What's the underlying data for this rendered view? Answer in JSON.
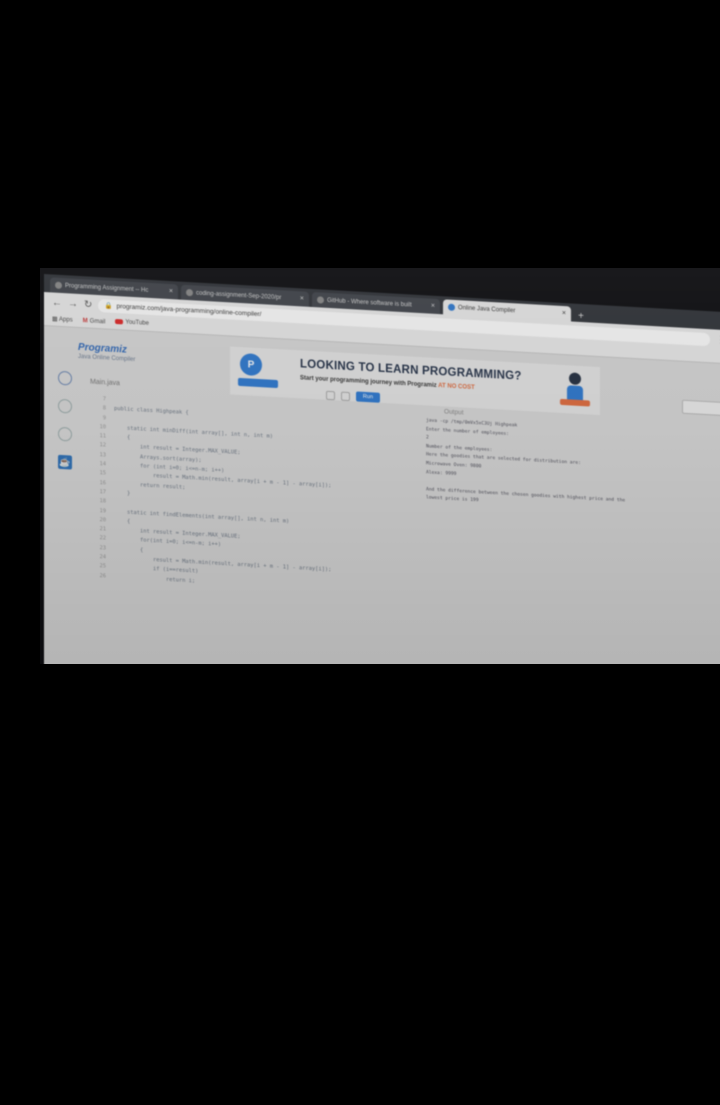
{
  "browser": {
    "tabs": [
      {
        "label": "Programming Assignment -- Hc",
        "active": false
      },
      {
        "label": "coding-assignment-Sep-2020/pr",
        "active": false
      },
      {
        "label": "GitHub - Where software is built",
        "active": false
      },
      {
        "label": "Online Java Compiler",
        "active": true
      }
    ],
    "url": "programiz.com/java-programming/online-compiler/",
    "bookmarks": [
      "Apps",
      "Gmail",
      "YouTube"
    ]
  },
  "brand": {
    "logo": "Programiz",
    "subtitle": "Java Online Compiler"
  },
  "banner": {
    "title": "LOOKING TO LEARN PROGRAMMING?",
    "subtitle": "Start your programming journey with Programiz",
    "accent": "AT NO COST"
  },
  "editor": {
    "file_name": "Main.java",
    "run_label": "Run",
    "lines": [
      {
        "n": "7",
        "text": ""
      },
      {
        "n": "8",
        "text": "public class Highpeak {"
      },
      {
        "n": "9",
        "text": ""
      },
      {
        "n": "10",
        "text": "    static int minDiff(int array[], int n, int m)"
      },
      {
        "n": "11",
        "text": "    {"
      },
      {
        "n": "12",
        "text": "        int result = Integer.MAX_VALUE;"
      },
      {
        "n": "13",
        "text": "        Arrays.sort(array);"
      },
      {
        "n": "14",
        "text": "        for (int i=0; i<=n-m; i++)"
      },
      {
        "n": "15",
        "text": "            result = Math.min(result, array[i + m - 1] - array[i]);"
      },
      {
        "n": "16",
        "text": "        return result;"
      },
      {
        "n": "17",
        "text": "    }"
      },
      {
        "n": "18",
        "text": ""
      },
      {
        "n": "19",
        "text": "    static int findElements(int array[], int n, int m)"
      },
      {
        "n": "20",
        "text": "    {"
      },
      {
        "n": "21",
        "text": "        int result = Integer.MAX_VALUE;"
      },
      {
        "n": "22",
        "text": "        for(int i=0; i<=n-m; i++)"
      },
      {
        "n": "23",
        "text": "        {"
      },
      {
        "n": "24",
        "text": "            result = Math.min(result, array[i + m - 1] - array[i]);"
      },
      {
        "n": "25",
        "text": "            if (i==result)"
      },
      {
        "n": "26",
        "text": "                return i;"
      }
    ]
  },
  "output": {
    "label": "Output",
    "lines": [
      "java -cp /tmp/0mVx5xC3Uj Highpeak",
      "Enter the number of employees:",
      "2",
      "Number of the employees:",
      "Here the goodies that are selected for distribution are:",
      "Microwave Oven: 9800",
      "Alexa: 9999",
      "",
      "And the difference between the chosen goodies with highest price and the",
      "lowest price is 199"
    ]
  },
  "colors": {
    "accent": "#2a78d2",
    "banner_accent": "#e26a3b"
  }
}
